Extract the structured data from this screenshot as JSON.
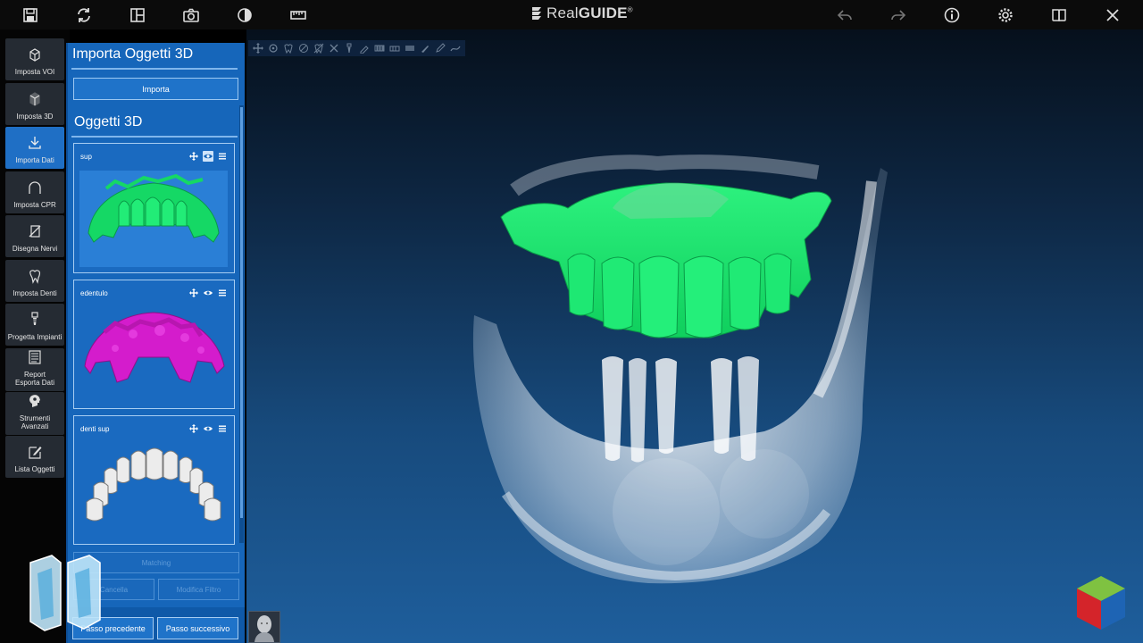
{
  "app": {
    "brand_light": "Real",
    "brand_bold": "GUIDE",
    "brand_mark": "®"
  },
  "topbar": {
    "left_icons": [
      "save-icon",
      "sync-icon",
      "layout-icon",
      "camera-icon",
      "contrast-icon",
      "ruler-icon"
    ],
    "right_icons": [
      "undo-icon",
      "redo-icon",
      "info-icon",
      "settings-icon",
      "book-icon",
      "close-icon"
    ]
  },
  "nav": [
    {
      "label": "Imposta VOI",
      "icon": "voi-cube-icon",
      "active": false
    },
    {
      "label": "Imposta 3D",
      "icon": "3d-cube-icon",
      "active": false
    },
    {
      "label": "Importa Dati",
      "icon": "download-icon",
      "active": true
    },
    {
      "label": "Imposta CPR",
      "icon": "arch-icon",
      "active": false
    },
    {
      "label": "Disegna Nervi",
      "icon": "nerve-icon",
      "active": false
    },
    {
      "label": "Imposta Denti",
      "icon": "tooth-icon",
      "active": false
    },
    {
      "label": "Progetta Impianti",
      "icon": "implant-icon",
      "active": false
    },
    {
      "label": "Report\nEsporta Dati",
      "icon": "report-icon",
      "active": false
    },
    {
      "label": "Strumenti\nAvanzati",
      "icon": "tools-head-icon",
      "active": false
    },
    {
      "label": "Lista Oggetti",
      "icon": "edit-list-icon",
      "active": false
    }
  ],
  "panel": {
    "title": "Importa Oggetti 3D",
    "import_button": "Importa",
    "section_title": "Oggetti 3D",
    "objects": [
      {
        "name": "sup",
        "color": "#19d86a",
        "eye_selected": true
      },
      {
        "name": "edentulo",
        "color": "#d21cc8",
        "eye_selected": false
      },
      {
        "name": "denti sup",
        "color": "#e9e9e9",
        "eye_selected": false
      }
    ],
    "matching_button": "Matching",
    "cancel_button": "Cancella",
    "edit_filter_button": "Modifica Filtro",
    "prev_button": "Passo precedente",
    "next_button": "Passo successivo"
  },
  "viewport": {
    "toolbar_icons": [
      "move-icon",
      "molar-icon",
      "tooth-outline-icon",
      "crown-icon",
      "tooth-crossed-icon",
      "x-icon",
      "implant-small-icon",
      "brush-icon",
      "teeth-row-icon",
      "teeth-row-2-icon",
      "gum-icon",
      "scalpel-icon",
      "pen-icon",
      "curve-icon"
    ],
    "colors": {
      "green_model": "#15e06a",
      "bone": "#dfe6ee",
      "background_top": "#06101c",
      "background_bottom": "#1e5e9c"
    }
  }
}
